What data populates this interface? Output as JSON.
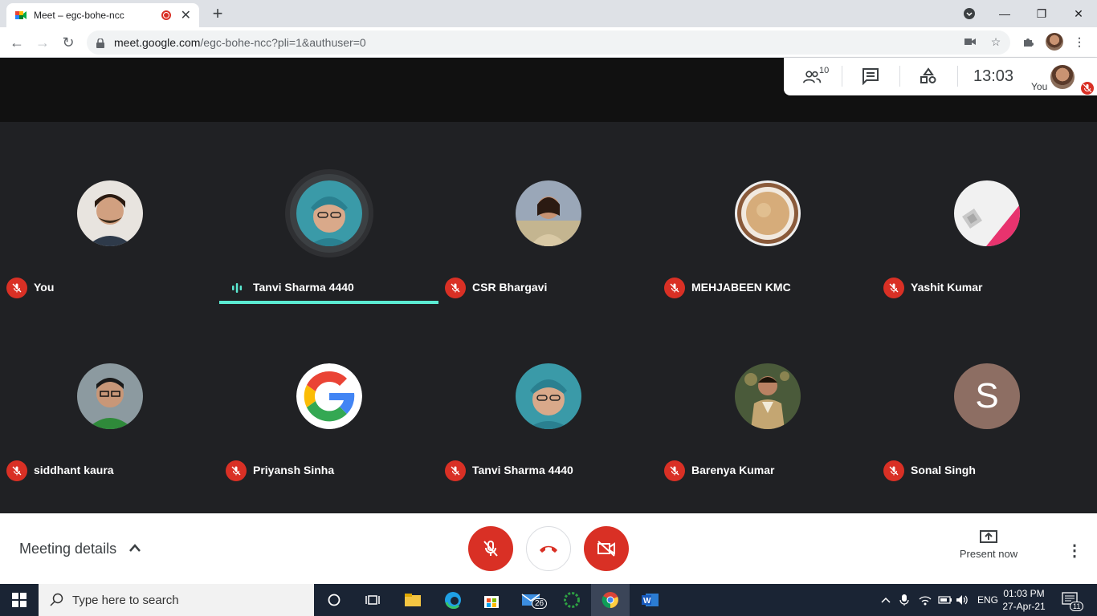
{
  "browser": {
    "tab_title": "Meet – egc-bohe-ncc",
    "url_host": "meet.google.com",
    "url_path": "/egc-bohe-ncc?pli=1&authuser=0"
  },
  "meet_header": {
    "participants_count": "10",
    "time": "13:03",
    "self_label": "You"
  },
  "participants": [
    {
      "name": "You",
      "muted": true,
      "avatar": "photo-man-beard",
      "color": "#b89a84"
    },
    {
      "name": "Tanvi Sharma 4440",
      "muted": false,
      "speaking": true,
      "avatar": "photo-woman-teal",
      "color": "#3a9aa8"
    },
    {
      "name": "CSR Bhargavi",
      "muted": true,
      "avatar": "photo-woman-outdoor",
      "color": "#9aa7b8"
    },
    {
      "name": "MEHJABEEN KMC",
      "muted": true,
      "avatar": "photo-tea-cup",
      "color": "#c89a6a"
    },
    {
      "name": "Yashit Kumar",
      "muted": true,
      "avatar": "graphic-pink",
      "color": "#e8336e"
    },
    {
      "name": "siddhant kaura",
      "muted": true,
      "avatar": "photo-man-glasses",
      "color": "#6d7d6a"
    },
    {
      "name": "Priyansh Sinha",
      "muted": true,
      "avatar": "google-logo",
      "color": "#ffffff"
    },
    {
      "name": "Tanvi Sharma 4440",
      "muted": true,
      "avatar": "photo-woman-teal",
      "color": "#3a9aa8"
    },
    {
      "name": "Barenya Kumar",
      "muted": true,
      "avatar": "photo-man-outdoor",
      "color": "#4a5a3a"
    },
    {
      "name": "Sonal Singh",
      "muted": true,
      "avatar": "letter",
      "letter": "S",
      "color": "#8d6e63"
    }
  ],
  "controls": {
    "meeting_details": "Meeting details",
    "present_now": "Present now"
  },
  "taskbar": {
    "search_placeholder": "Type here to search",
    "mail_badge": "26",
    "language": "ENG",
    "time": "01:03 PM",
    "date": "27-Apr-21",
    "notifications": "11"
  }
}
